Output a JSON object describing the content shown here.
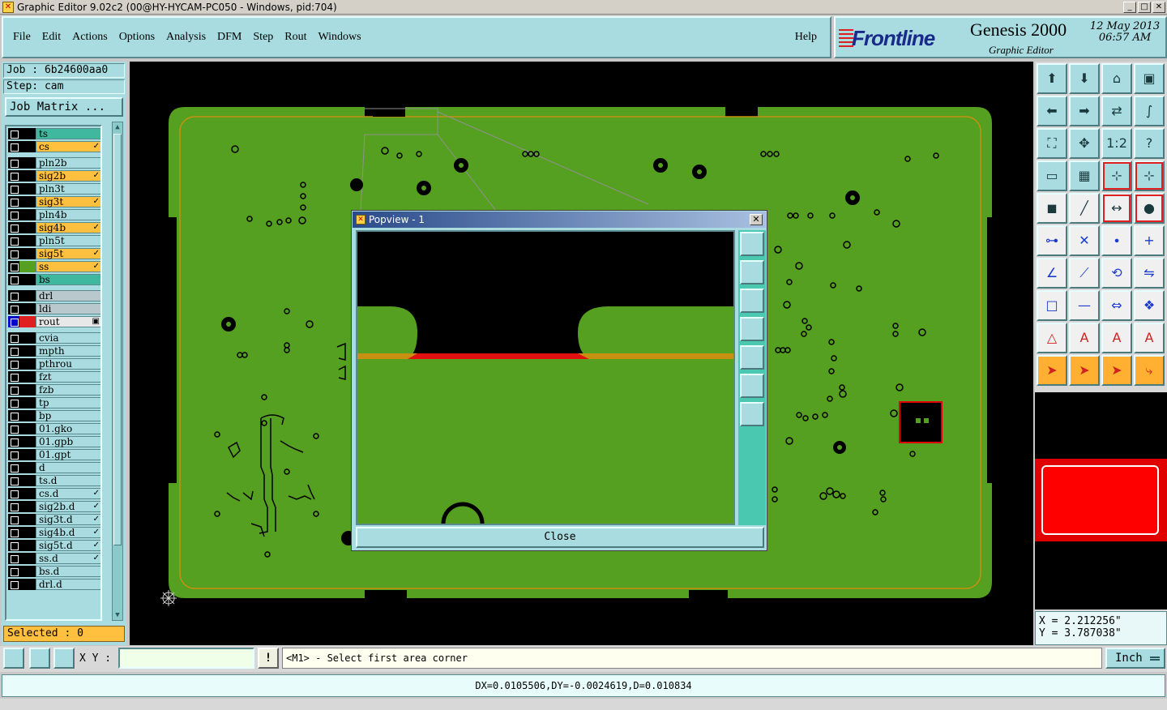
{
  "window": {
    "title": "Graphic Editor 9.02c2 (00@HY-HYCAM-PC050 - Windows, pid:704)",
    "min": "_",
    "max": "□",
    "close": "✕"
  },
  "menu": [
    "File",
    "Edit",
    "Actions",
    "Options",
    "Analysis",
    "DFM",
    "Step",
    "Rout",
    "Windows"
  ],
  "help": "Help",
  "brand": {
    "logo": "Frontline",
    "product": "Genesis 2000",
    "subtitle": "Graphic Editor",
    "date": "12 May 2013",
    "time": "06:57 AM"
  },
  "job": {
    "job_line": "Job : 6b24600aa0",
    "step_line": "Step: cam",
    "matrix_button": "Job Matrix ..."
  },
  "layers": [
    {
      "name": "ts",
      "style": "teal",
      "mark": ""
    },
    {
      "name": "cs",
      "style": "board",
      "mark": "✓"
    },
    {
      "name": "pln2b",
      "style": "plain",
      "mark": ""
    },
    {
      "name": "sig2b",
      "style": "board",
      "mark": "✓"
    },
    {
      "name": "pln3t",
      "style": "plain",
      "mark": ""
    },
    {
      "name": "sig3t",
      "style": "board",
      "mark": "✓"
    },
    {
      "name": "pln4b",
      "style": "plain",
      "mark": ""
    },
    {
      "name": "sig4b",
      "style": "board",
      "mark": "✓"
    },
    {
      "name": "pln5t",
      "style": "plain",
      "mark": ""
    },
    {
      "name": "sig5t",
      "style": "board",
      "mark": "✓"
    },
    {
      "name": "ss",
      "style": "board",
      "mark": "✓"
    },
    {
      "name": "bs",
      "style": "teal",
      "mark": ""
    },
    {
      "name": "drl",
      "style": "gray",
      "mark": ""
    },
    {
      "name": "ldi",
      "style": "gray",
      "mark": ""
    },
    {
      "name": "rout",
      "style": "white",
      "mark": "▣"
    },
    {
      "name": "cvia",
      "style": "plain",
      "mark": ""
    },
    {
      "name": "mpth",
      "style": "plain",
      "mark": ""
    },
    {
      "name": "pthrou",
      "style": "plain",
      "mark": ""
    },
    {
      "name": "fzt",
      "style": "plain",
      "mark": ""
    },
    {
      "name": "fzb",
      "style": "plain",
      "mark": ""
    },
    {
      "name": "tp",
      "style": "plain",
      "mark": ""
    },
    {
      "name": "bp",
      "style": "plain",
      "mark": ""
    },
    {
      "name": "01.gko",
      "style": "plain",
      "mark": ""
    },
    {
      "name": "01.gpb",
      "style": "plain",
      "mark": ""
    },
    {
      "name": "01.gpt",
      "style": "plain",
      "mark": ""
    },
    {
      "name": "d",
      "style": "plain",
      "mark": ""
    },
    {
      "name": "ts.d",
      "style": "plain",
      "mark": ""
    },
    {
      "name": "cs.d",
      "style": "plain",
      "mark": "✓"
    },
    {
      "name": "sig2b.d",
      "style": "plain",
      "mark": "✓"
    },
    {
      "name": "sig3t.d",
      "style": "plain",
      "mark": "✓"
    },
    {
      "name": "sig4b.d",
      "style": "plain",
      "mark": "✓"
    },
    {
      "name": "sig5t.d",
      "style": "plain",
      "mark": "✓"
    },
    {
      "name": "ss.d",
      "style": "plain",
      "mark": "✓"
    },
    {
      "name": "bs.d",
      "style": "plain",
      "mark": ""
    },
    {
      "name": "drl.d",
      "style": "plain",
      "mark": ""
    }
  ],
  "selected": "Selected : 0",
  "popview": {
    "title": "Popview - 1",
    "close_label": "Close"
  },
  "coords": {
    "x": "X = 2.212256\"",
    "y": "Y = 3.787038\""
  },
  "bottom": {
    "xy_label": "X Y :",
    "xy_value": "",
    "bang": "!",
    "prompt": "<M1> - Select first area corner",
    "unit": "Inch"
  },
  "status": "DX=0.0105506,DY=-0.0024619,D=0.010834",
  "colors": {
    "board": "#55a020",
    "panel": "#a8dce0",
    "rout_line": "#c89010",
    "highlight": "#e00000"
  },
  "tool_icons": [
    "move-up-icon",
    "move-down-icon",
    "home-icon",
    "panel-icon",
    "left-icon",
    "right-icon",
    "swap-icon",
    "s-curve-icon",
    "zoom-fit-icon",
    "zoom-center-icon",
    "scale-1-2-icon",
    "help-icon",
    "ruler-icon",
    "grid-icon",
    "snap-icon",
    "snap2-icon",
    "pad-icon",
    "line-icon",
    "measure-icon",
    "circle-icon",
    "connect-icon",
    "cross-icon",
    "vertex-icon",
    "add-vertex-icon",
    "angle-icon",
    "diag-icon",
    "arc-icon",
    "flip-icon",
    "square-icon",
    "dash-icon",
    "resize-icon",
    "group-icon",
    "triangle-icon",
    "a-icon",
    "a2-icon",
    "a3-icon",
    "pointer-icon",
    "pointer2-icon",
    "pointer3-icon",
    "route-icon"
  ]
}
